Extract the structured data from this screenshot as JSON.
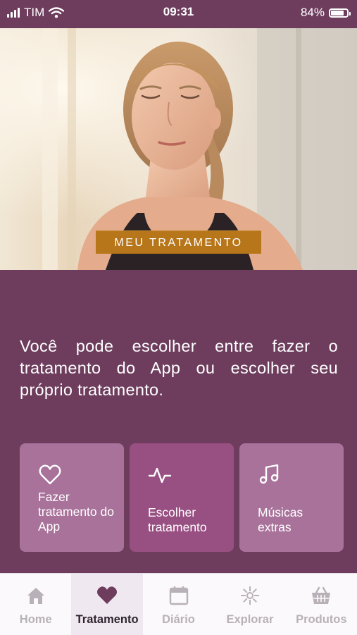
{
  "status_bar": {
    "carrier": "TIM",
    "time": "09:31",
    "battery": "84%",
    "battery_level": 0.84
  },
  "hero": {
    "badge": "MEU TRATAMENTO",
    "image": "woman-meditating-photo"
  },
  "intro": {
    "text": "Você pode escolher entre fazer o tratamento do App ou escolher seu próprio tratamento."
  },
  "cards": [
    {
      "label": "Fazer tratamento do App",
      "icon": "heart-outline-icon"
    },
    {
      "label": "Escolher tratamento",
      "icon": "pulse-icon"
    },
    {
      "label": "Músicas extras",
      "icon": "music-note-icon"
    }
  ],
  "tabs": [
    {
      "label": "Home",
      "icon": "home-icon"
    },
    {
      "label": "Tratamento",
      "icon": "heart-icon",
      "active": true
    },
    {
      "label": "Diário",
      "icon": "calendar-icon"
    },
    {
      "label": "Explorar",
      "icon": "mandala-icon"
    },
    {
      "label": "Produtos",
      "icon": "basket-icon"
    }
  ],
  "colors": {
    "brand": "#6e3d5d",
    "card": "#a8729a",
    "card_selected": "#984f82",
    "badge": "#b7761a"
  }
}
